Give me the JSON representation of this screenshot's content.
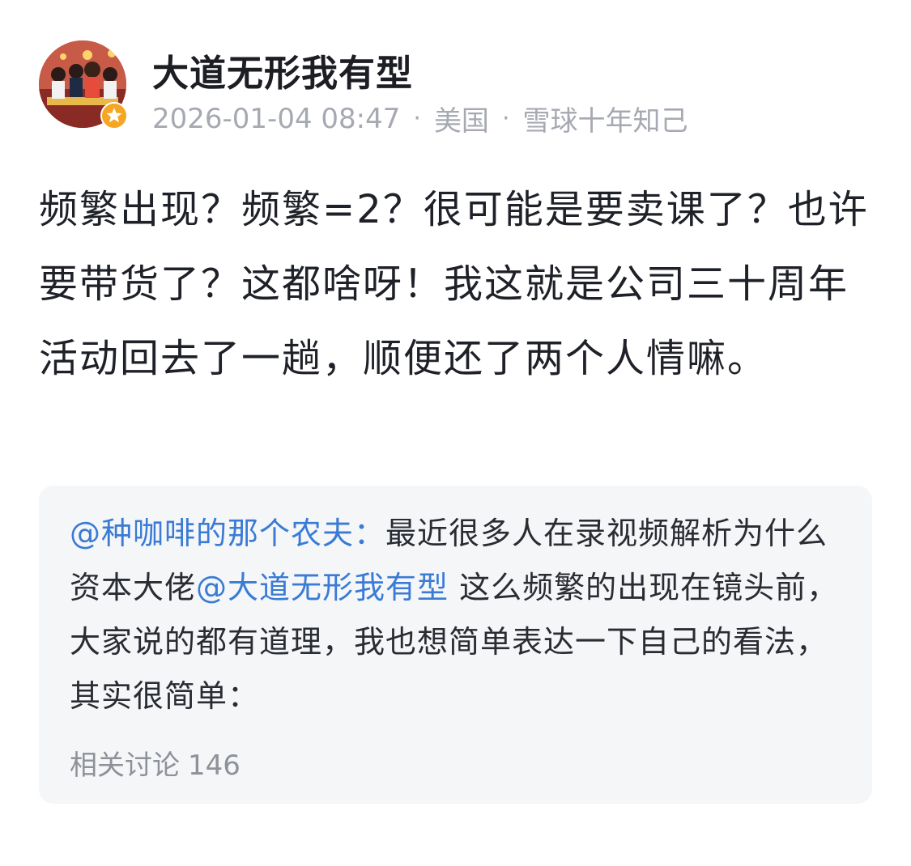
{
  "author": {
    "name": "大道无形我有型",
    "avatar": "avatar",
    "badge_icon": "verified-star-icon",
    "badge_color": "#f5a623"
  },
  "meta": {
    "datetime": "2026-01-04 08:47",
    "location": "美国",
    "tag": "雪球十年知己",
    "separator": "·"
  },
  "post": {
    "text": "频繁出现？频繁=2？很可能是要卖课了？也许要带货了？这都啥呀！我这就是公司三十周年活动回去了一趟，顺便还了两个人情嘛。"
  },
  "quote": {
    "author_mention": "@种咖啡的那个农夫：",
    "text_before_mention": "最近很多人在录视频解析为什么资本大佬",
    "inline_mention": "@大道无形我有型",
    "text_after_mention": " 这么频繁的出现在镜头前，大家说的都有道理，我也想简单表达一下自己的看法，其实很简单：",
    "related_label": "相关讨论",
    "related_count": "146"
  },
  "colors": {
    "mention": "#3a7bd5",
    "meta_text": "#a6a9b2",
    "card_background": "#f5f6f8"
  }
}
